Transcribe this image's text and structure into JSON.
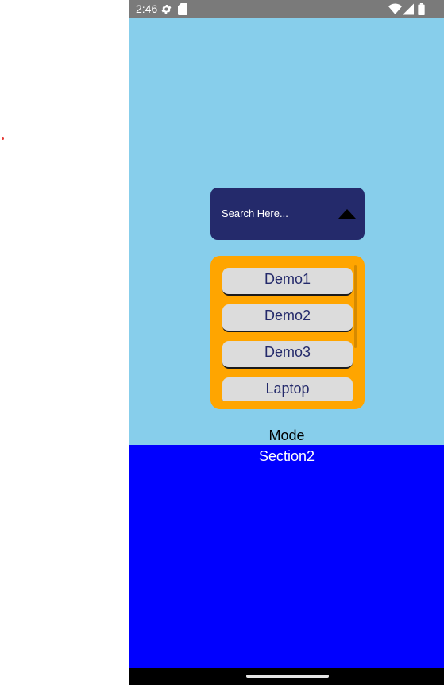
{
  "status_bar": {
    "time": "2:46",
    "icons": [
      "settings-gear-icon",
      "sd-card-icon",
      "wifi-icon",
      "signal-icon",
      "battery-icon"
    ]
  },
  "search": {
    "placeholder": "Search Here...",
    "toggle_icon": "caret-up-icon"
  },
  "dropdown": {
    "items": [
      {
        "label": "Demo1"
      },
      {
        "label": "Demo2"
      },
      {
        "label": "Demo3"
      },
      {
        "label": "Laptop"
      }
    ]
  },
  "labels": {
    "mode": "Mode",
    "section2": "Section2"
  },
  "colors": {
    "background": "#87ceeb",
    "search_bg": "#242a6b",
    "dropdown_bg": "#ffa500",
    "item_bg": "#dcdcdc",
    "section2_bg": "#0000ff",
    "status_bar": "#7a7a7a"
  }
}
